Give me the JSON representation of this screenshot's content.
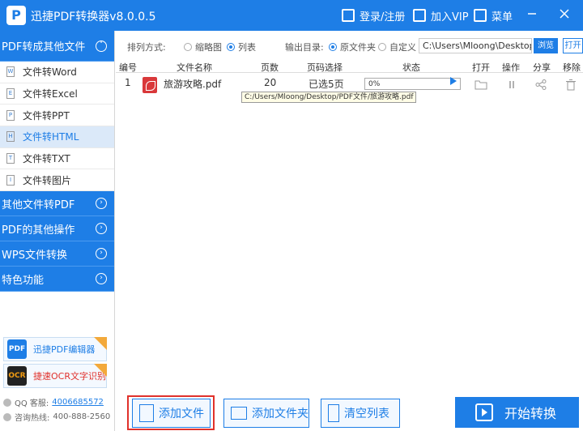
{
  "app": {
    "title": "迅捷PDF转换器v8.0.0.5",
    "logo": "P"
  },
  "topbar": {
    "login_label": "登录/注册",
    "vip_label": "加入VIP",
    "menu_label": "菜单"
  },
  "sidebar": {
    "sections": [
      {
        "label": "PDF转成其他文件",
        "expanded": true
      },
      {
        "label": "其他文件转PDF"
      },
      {
        "label": "PDF的其他操作"
      },
      {
        "label": "WPS文件转换"
      },
      {
        "label": "特色功能"
      }
    ],
    "items": [
      {
        "label": "文件转Word",
        "icon": "W"
      },
      {
        "label": "文件转Excel",
        "icon": "E"
      },
      {
        "label": "文件转PPT",
        "icon": "P"
      },
      {
        "label": "文件转HTML",
        "icon": "H"
      },
      {
        "label": "文件转TXT",
        "icon": "T"
      },
      {
        "label": "文件转图片",
        "icon": "I"
      }
    ],
    "promos": [
      {
        "label": "迅捷PDF编辑器",
        "icon_text": "PDF"
      },
      {
        "label": "捷速OCR文字识别",
        "icon_text": "OCR"
      }
    ],
    "contact": {
      "qq_label": "QQ 客服:",
      "qq_value": "4006685572",
      "phone_label": "咨询热线:",
      "phone_value": "400-888-2560"
    }
  },
  "options": {
    "sort_label": "排列方式:",
    "thumb_label": "缩略图",
    "list_label": "列表",
    "output_label": "输出目录:",
    "source_folder_label": "原文件夹",
    "custom_label": "自定义",
    "path_value": "C:\\Users\\Mloong\\Desktop",
    "browse_label": "浏览",
    "open_label": "打开"
  },
  "table": {
    "headers": [
      "编号",
      "文件名称",
      "页数",
      "页码选择",
      "状态",
      "打开",
      "操作",
      "分享",
      "移除"
    ],
    "rows": [
      {
        "index": "1",
        "name": "旅游攻略.pdf",
        "pages": "20",
        "page_select": "已选5页",
        "progress_text": "0%",
        "progress": 0.0
      }
    ],
    "tooltip": "C:/Users/Mloong/Desktop/PDF文件/旅游攻略.pdf"
  },
  "bottom": {
    "add_file_label": "添加文件",
    "add_folder_label": "添加文件夹",
    "clear_label": "清空列表",
    "start_label": "开始转换"
  },
  "colors": {
    "accent": "#1e7ee6",
    "highlight": "#e0312b",
    "pdf_red": "#d9383a"
  }
}
